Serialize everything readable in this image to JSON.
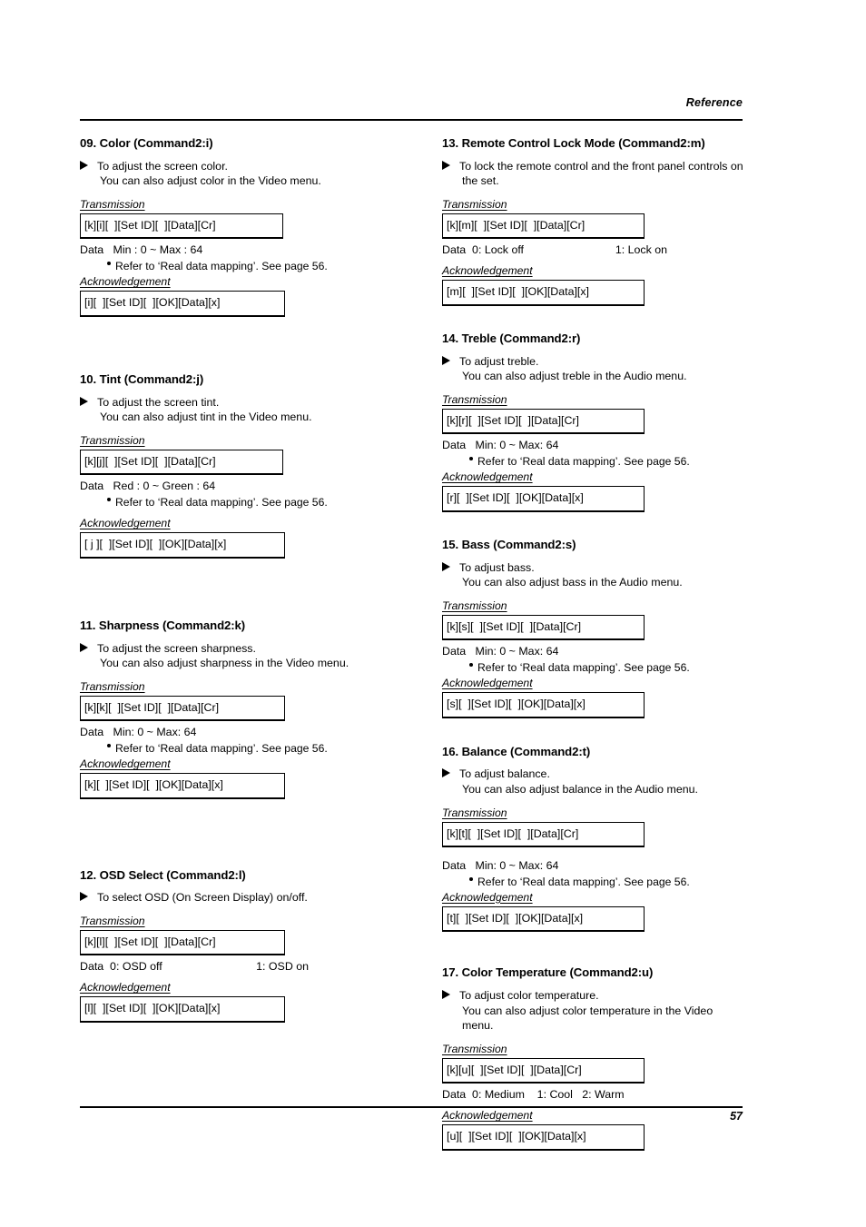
{
  "header": {
    "running_head": "Reference"
  },
  "footer": {
    "page_number": "57"
  },
  "labels": {
    "transmission": "Transmission",
    "acknowledgement": "Acknowledgement",
    "data": "Data",
    "refer_note": "Refer to ‘Real data mapping’. See page 56."
  },
  "sections": {
    "s09": {
      "title": "09. Color (Command2:i)",
      "desc_line1": "To adjust the screen color.",
      "desc_line2": "You can also adjust color in the Video menu.",
      "transmission": "[k][i][  ][Set ID][  ][Data][Cr]",
      "data_text": "Data   Min : 0 ~ Max : 64",
      "acknowledgement": "[i][  ][Set ID][  ][OK][Data][x]"
    },
    "s10": {
      "title": "10. Tint (Command2:j)",
      "desc_line1": "To adjust the screen tint.",
      "desc_line2": "You can also adjust tint in the Video menu.",
      "transmission": "[k][j][  ][Set ID][  ][Data][Cr]",
      "data_text": "Data   Red : 0 ~ Green : 64",
      "acknowledgement": "[ j ][  ][Set ID][  ][OK][Data][x]"
    },
    "s11": {
      "title": "11. Sharpness (Command2:k)",
      "desc_line1": "To adjust the screen sharpness.",
      "desc_line2": "You can also adjust sharpness in the Video menu.",
      "transmission": "[k][k][  ][Set ID][  ][Data][Cr]",
      "data_text": "Data   Min: 0 ~ Max: 64",
      "acknowledgement": "[k][  ][Set ID][  ][OK][Data][x]"
    },
    "s12": {
      "title": "12. OSD Select (Command2:l)",
      "desc_line1": "To select OSD (On Screen Display) on/off.",
      "transmission": "[k][l][  ][Set ID][  ][Data][Cr]",
      "data_left": "Data  0: OSD off",
      "data_right": "1: OSD on",
      "acknowledgement": "[l][  ][Set ID][  ][OK][Data][x]"
    },
    "s13": {
      "title": "13. Remote Control Lock Mode (Command2:m)",
      "desc_line1": "To lock the remote control and the front panel controls on",
      "desc_line2": "the set.",
      "transmission": "[k][m][  ][Set ID][  ][Data][Cr]",
      "data_left": "Data  0: Lock off",
      "data_right": "1: Lock on",
      "acknowledgement": "[m][  ][Set ID][  ][OK][Data][x]"
    },
    "s14": {
      "title": "14. Treble (Command2:r)",
      "desc_line1": "To adjust treble.",
      "desc_line2": "You can also adjust treble in the Audio menu.",
      "transmission": "[k][r][  ][Set ID][  ][Data][Cr]",
      "data_text": "Data   Min: 0 ~ Max: 64",
      "acknowledgement": "[r][  ][Set ID][  ][OK][Data][x]"
    },
    "s15": {
      "title": "15. Bass (Command2:s)",
      "desc_line1": "To adjust bass.",
      "desc_line2": "You can also adjust bass in the Audio menu.",
      "transmission": "[k][s][  ][Set ID][  ][Data][Cr]",
      "data_text": "Data   Min: 0 ~ Max: 64",
      "acknowledgement": "[s][  ][Set ID][  ][OK][Data][x]"
    },
    "s16": {
      "title": "16. Balance (Command2:t)",
      "desc_line1": "To adjust balance.",
      "desc_line2": "You can also adjust balance in the Audio menu.",
      "transmission": "[k][t][  ][Set ID][  ][Data][Cr]",
      "data_text": "Data   Min: 0 ~ Max: 64",
      "acknowledgement": "[t][  ][Set ID][  ][OK][Data][x]"
    },
    "s17": {
      "title": "17. Color Temperature (Command2:u)",
      "desc_line1": "To adjust color temperature.",
      "desc_line2": "You can also adjust color temperature in the Video",
      "desc_line3": "menu.",
      "transmission": "[k][u][  ][Set ID][  ][Data][Cr]",
      "data_text": "Data  0: Medium    1: Cool   2: Warm",
      "acknowledgement": "[u][  ][Set ID][  ][OK][Data][x]"
    }
  }
}
